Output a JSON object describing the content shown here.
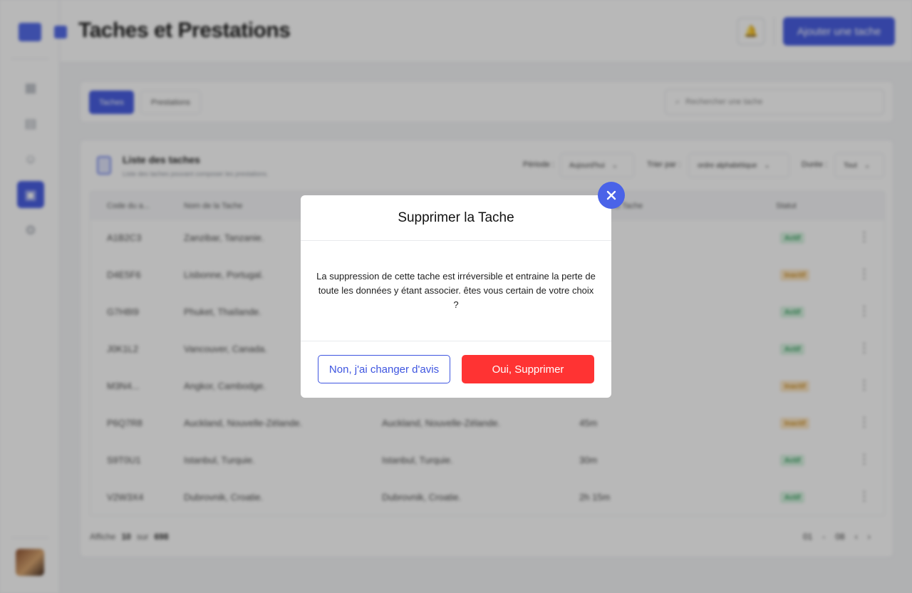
{
  "header": {
    "title": "Taches et Prestations",
    "add_button": "Ajouter une tache"
  },
  "sidebar": {
    "icons": [
      "dashboard-icon",
      "calendar-icon",
      "users-icon",
      "bag-icon",
      "settings-icon"
    ],
    "active": "bag-icon"
  },
  "tabs": [
    "Taches",
    "Prestations"
  ],
  "search": {
    "placeholder": "Rechercher une tache"
  },
  "list": {
    "title": "Liste des taches",
    "subtitle": "Liste des taches pouvant composer les prestations.",
    "filters": {
      "period_label": "Période :",
      "period_value": "Aujourd'hui",
      "sort_label": "Trier par :",
      "sort_value": "ordre alphabétique",
      "duration_label": "Durée :",
      "duration_value": "Tout"
    },
    "columns": [
      "Code du a...",
      "Nom de la Tache",
      "",
      "Durée de la Tache",
      "Statut"
    ],
    "rows": [
      {
        "code": "A1B2C3",
        "name": "Zanzibar, Tanzanie.",
        "desc": "",
        "duration": "",
        "status": "Actif",
        "ok": true
      },
      {
        "code": "D4E5F6",
        "name": "Lisbonne, Portugal.",
        "desc": "",
        "duration": "",
        "status": "Inactif",
        "ok": false
      },
      {
        "code": "G7H8I9",
        "name": "Phuket, Thaïlande.",
        "desc": "",
        "duration": "",
        "status": "Actif",
        "ok": true
      },
      {
        "code": "J0K1L2",
        "name": "Vancouver, Canada.",
        "desc": "",
        "duration": "",
        "status": "Actif",
        "ok": true
      },
      {
        "code": "M3N4...",
        "name": "Angkor, Cambodge.",
        "desc": "",
        "duration": "",
        "status": "Inactif",
        "ok": false
      },
      {
        "code": "P6Q7R8",
        "name": "Auckland, Nouvelle-Zélande.",
        "desc": "Auckland, Nouvelle-Zélande.",
        "duration": "45m",
        "status": "Inactif",
        "ok": false
      },
      {
        "code": "S9T0U1",
        "name": "Istanbul, Turquie.",
        "desc": "Istanbul, Turquie.",
        "duration": "30m",
        "status": "Actif",
        "ok": true
      },
      {
        "code": "V2W3X4",
        "name": "Dubrovnik, Croatie.",
        "desc": "Dubrovnik, Croatie.",
        "duration": "2h 15m",
        "status": "Actif",
        "ok": true
      }
    ],
    "footer": {
      "prefix": "Affiche",
      "count": "10",
      "mid": "sur",
      "total": "698",
      "page_from": "01",
      "page_sep": "-",
      "page_to": "08"
    }
  },
  "modal": {
    "title": "Supprimer la Tache",
    "body": "La suppression de cette tache est irréversible et entraine la perte de toute les données y étant associer. êtes vous certain de votre choix ?",
    "cancel_label": "Non, j'ai changer d'avis",
    "confirm_label": "Oui, Supprimer"
  },
  "colors": {
    "primary": "#3e55e0",
    "danger": "#ff3333"
  }
}
